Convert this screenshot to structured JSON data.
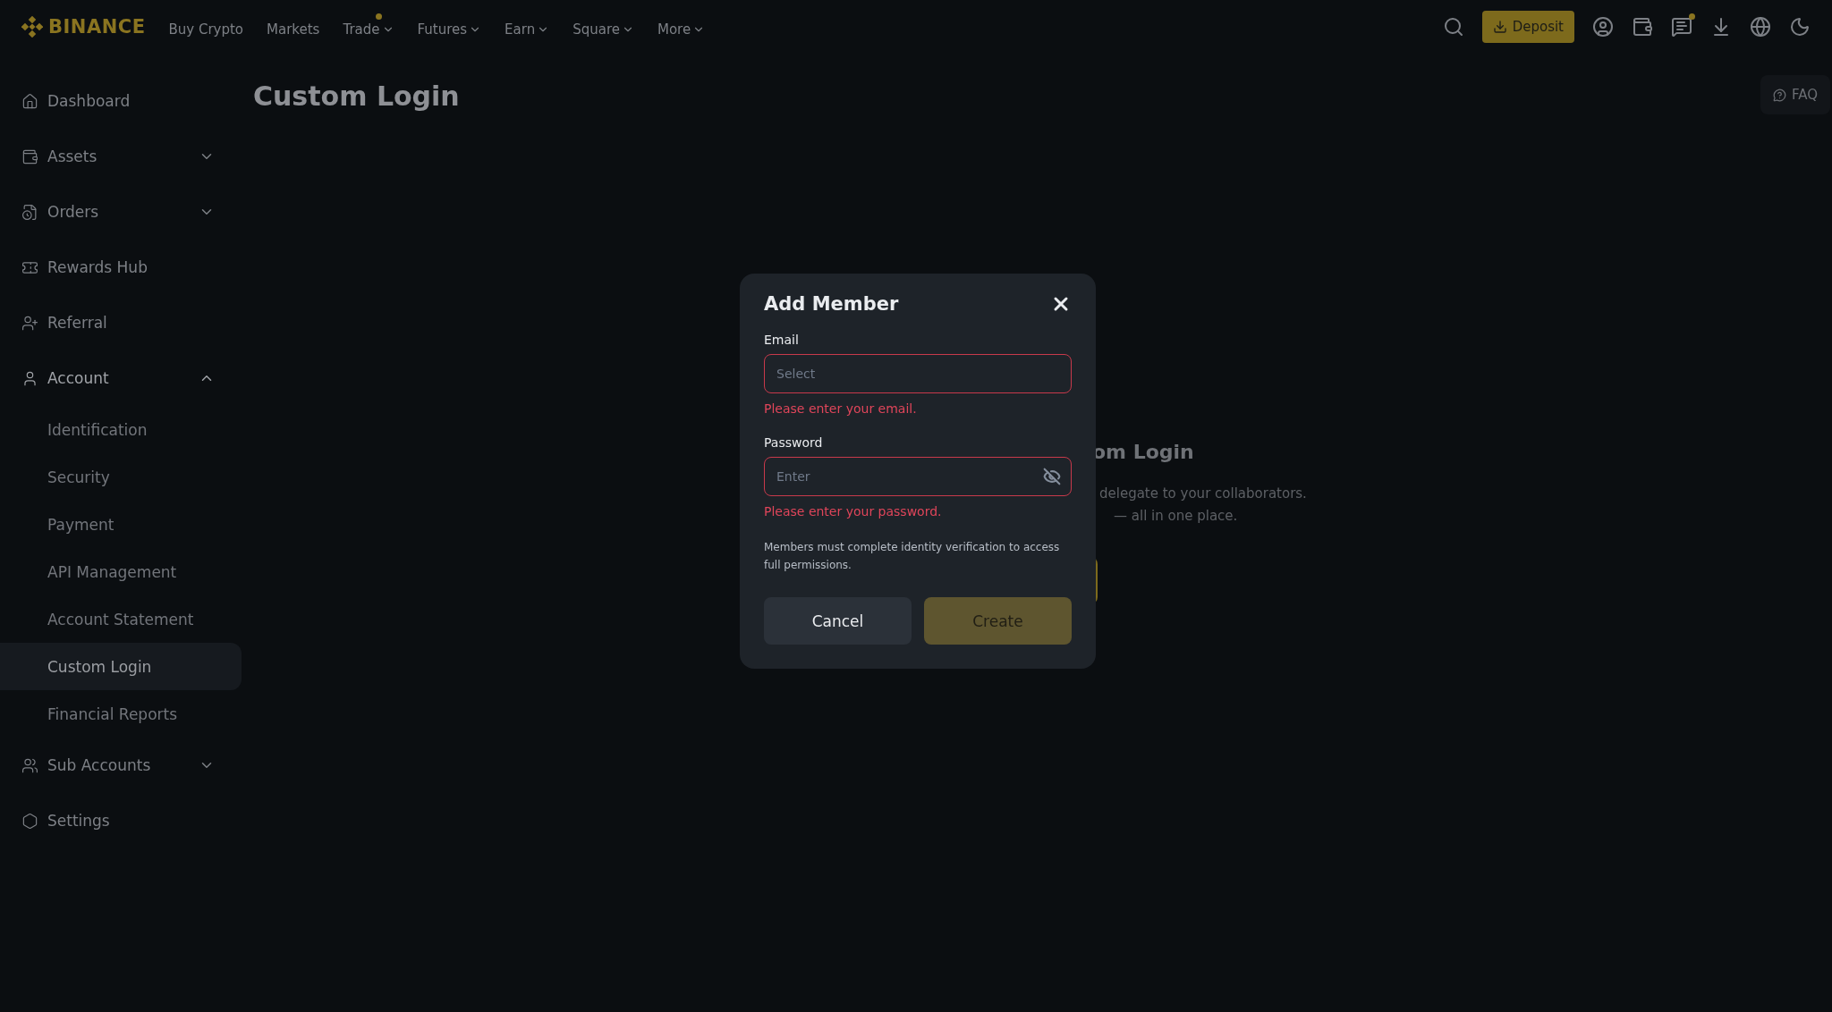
{
  "header": {
    "logo": "BINANCE",
    "nav": [
      {
        "label": "Buy Crypto",
        "dropdown": false,
        "dot": false
      },
      {
        "label": "Markets",
        "dropdown": false,
        "dot": false
      },
      {
        "label": "Trade",
        "dropdown": true,
        "dot": true
      },
      {
        "label": "Futures",
        "dropdown": true,
        "dot": false
      },
      {
        "label": "Earn",
        "dropdown": true,
        "dot": false
      },
      {
        "label": "Square",
        "dropdown": true,
        "dot": false
      },
      {
        "label": "More",
        "dropdown": true,
        "dot": false
      }
    ],
    "deposit": "Deposit",
    "tools": [
      {
        "kind": "user",
        "dot": false
      },
      {
        "kind": "wallet",
        "dot": false
      },
      {
        "kind": "messages",
        "dot": true
      },
      {
        "kind": "download",
        "dot": false
      },
      {
        "kind": "globe",
        "dot": false
      },
      {
        "kind": "theme",
        "dot": false
      }
    ]
  },
  "sidebar": {
    "items": [
      {
        "label": "Dashboard",
        "dropdown": false,
        "expanded": false
      },
      {
        "label": "Assets",
        "dropdown": true,
        "expanded": false
      },
      {
        "label": "Orders",
        "dropdown": true,
        "expanded": false
      },
      {
        "label": "Rewards Hub",
        "dropdown": false,
        "expanded": false
      },
      {
        "label": "Referral",
        "dropdown": false,
        "expanded": false
      },
      {
        "label": "Account",
        "dropdown": true,
        "expanded": true,
        "children": [
          {
            "label": "Identification",
            "selected": false
          },
          {
            "label": "Security",
            "selected": false
          },
          {
            "label": "Payment",
            "selected": false
          },
          {
            "label": "API Management",
            "selected": false
          },
          {
            "label": "Account Statement",
            "selected": false
          },
          {
            "label": "Custom Login",
            "selected": true
          },
          {
            "label": "Financial Reports",
            "selected": false
          }
        ]
      },
      {
        "label": "Sub Accounts",
        "dropdown": true,
        "expanded": false
      },
      {
        "label": "Settings",
        "dropdown": false,
        "expanded": false
      }
    ]
  },
  "page": {
    "title": "Custom Login",
    "faq": "FAQ",
    "empty_state": {
      "title": "om Login",
      "lines": [
        "delegate to your collaborators.",
        "— all in one place."
      ]
    }
  },
  "dialog": {
    "title": "Add Member",
    "fields": [
      {
        "label": "Email",
        "placeholder": "Select",
        "error": "Please enter your email.",
        "invalid": true,
        "kind": "select"
      },
      {
        "label": "Password",
        "placeholder": "Enter",
        "error": "Please enter your password.",
        "invalid": true,
        "kind": "password"
      }
    ],
    "note": "Members must complete identity verification to access full permissions.",
    "buttons": [
      {
        "label": "Cancel",
        "kind": "secondary",
        "disabled": false
      },
      {
        "label": "Create",
        "kind": "primary",
        "disabled": true
      }
    ]
  }
}
